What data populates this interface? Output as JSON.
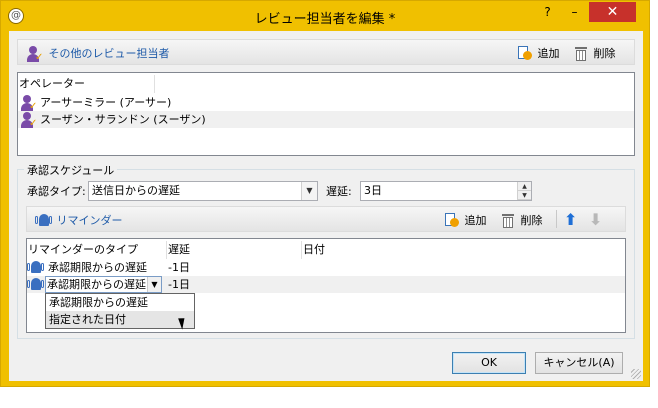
{
  "window": {
    "title": "レビュー担当者を編集 *",
    "help_glyph": "?",
    "minimize_glyph": "–",
    "close_glyph": "✕",
    "app_icon": "@",
    "frame_color": "#f0c000",
    "close_color": "#c7312b"
  },
  "reviewers": {
    "section_label": "その他のレビュー担当者",
    "add_label": "追加",
    "delete_label": "削除",
    "column_header": "オペレーター",
    "rows": [
      {
        "name": "アーサーミラー (アーサー)"
      },
      {
        "name": "スーザン・サランドン (スーザン)"
      }
    ]
  },
  "schedule": {
    "legend": "承認スケジュール",
    "type_label": "承認タイプ:",
    "type_value": "送信日からの遅延",
    "delay_label": "遅延:",
    "delay_value": "3日",
    "reminder": {
      "label": "リマインダー",
      "add_label": "追加",
      "delete_label": "削除",
      "columns": [
        "リマインダーのタイプ",
        "遅延",
        "日付"
      ],
      "rows": [
        {
          "type": "承認期限からの遅延",
          "delay": "-1日",
          "date": ""
        },
        {
          "type": "承認期限からの遅延",
          "delay": "-1日",
          "date": ""
        }
      ],
      "dropdown_options": [
        "承認期限からの遅延",
        "指定された日付"
      ]
    }
  },
  "buttons": {
    "ok": "OK",
    "cancel": "キャンセル(A)"
  },
  "colors": {
    "link_blue": "#1e5aa8",
    "person_purple": "#7a4ba8",
    "arrow_blue": "#1f6fd6"
  }
}
